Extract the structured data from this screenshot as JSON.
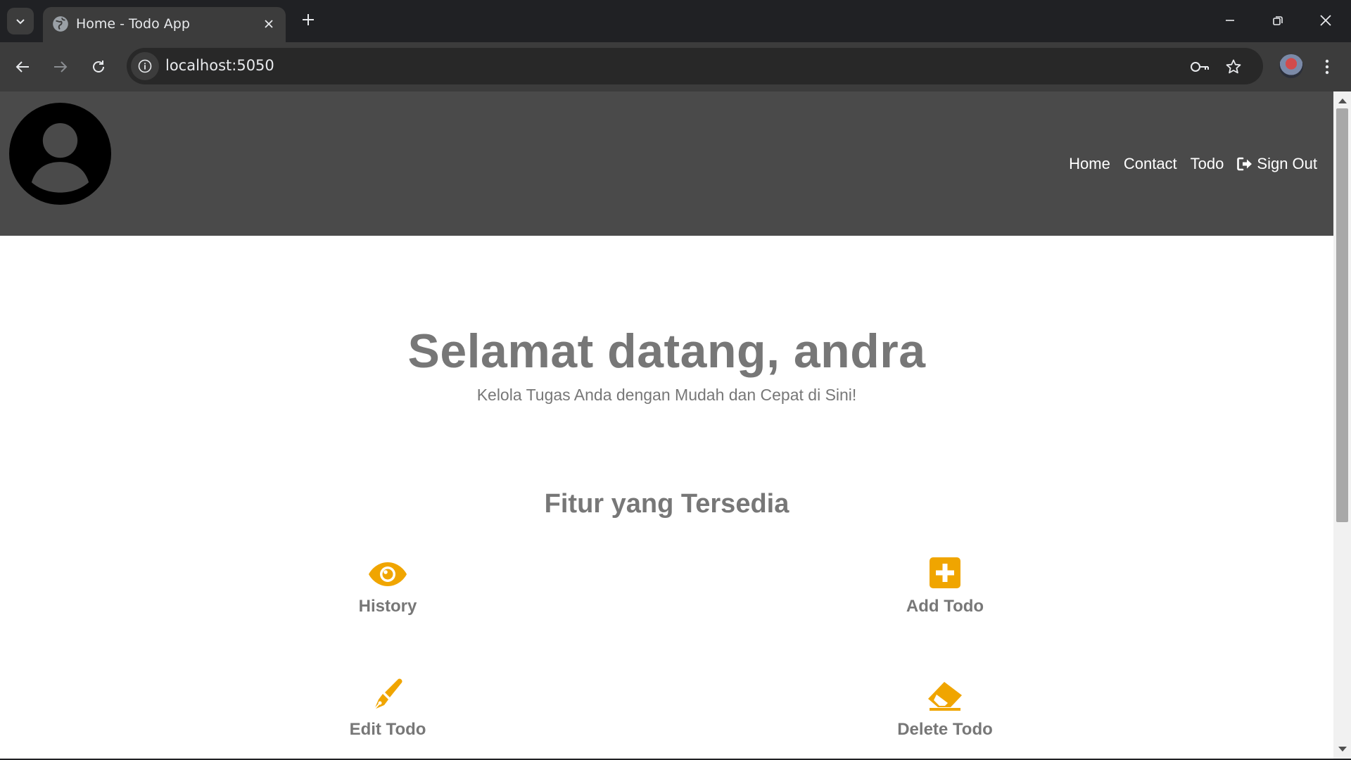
{
  "browser": {
    "tab_title": "Home - Todo App",
    "url": "localhost:5050"
  },
  "header": {
    "nav": [
      {
        "label": "Home"
      },
      {
        "label": "Contact"
      },
      {
        "label": "Todo"
      },
      {
        "label": "Sign Out",
        "icon": "sign-out-icon"
      }
    ]
  },
  "hero": {
    "title": "Selamat datang, andra",
    "subtitle": "Kelola Tugas Anda dengan Mudah dan Cepat di Sini!"
  },
  "features": {
    "heading": "Fitur yang Tersedia",
    "items": [
      {
        "label": "History",
        "icon": "eye-icon"
      },
      {
        "label": "Add Todo",
        "icon": "plus-square-icon"
      },
      {
        "label": "Edit Todo",
        "icon": "pen-icon"
      },
      {
        "label": "Delete Todo",
        "icon": "eraser-icon"
      }
    ]
  },
  "colors": {
    "accent": "#f0a500",
    "header_bg": "#4a4a4a",
    "text_muted": "#777777"
  }
}
